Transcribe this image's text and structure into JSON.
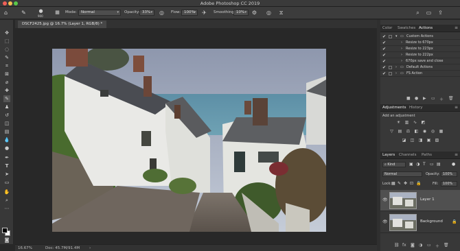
{
  "window": {
    "title": "Adobe Photoshop CC 2019"
  },
  "options_bar": {
    "brush_size": "900",
    "mode_label": "Mode:",
    "mode_value": "Normal",
    "opacity_label": "Opacity:",
    "opacity_value": "33%",
    "flow_label": "Flow:",
    "flow_value": "100%",
    "smoothing_label": "Smoothing:",
    "smoothing_value": "10%"
  },
  "document": {
    "tab_title": "DSCF2425.jpg @ 16.7% (Layer 1, RGB/8) *"
  },
  "status_bar": {
    "zoom": "16.67%",
    "doc_info": "Doc: 45.7M/91.4M"
  },
  "top_panel": {
    "tabs": [
      "Color",
      "Swatches",
      "Actions"
    ],
    "actions": [
      {
        "label": "Custom Actions",
        "type": "set",
        "expanded": true
      },
      {
        "label": "Resize to 670px",
        "type": "action"
      },
      {
        "label": "Resize to 223px",
        "type": "action"
      },
      {
        "label": "Resize to 222px",
        "type": "action"
      },
      {
        "label": "670px save and close",
        "type": "action"
      },
      {
        "label": "Default Actions",
        "type": "set",
        "expanded": false
      },
      {
        "label": "FS Action",
        "type": "set",
        "expanded": false
      }
    ]
  },
  "adjustments_panel": {
    "tabs": [
      "Adjustments",
      "History"
    ],
    "hint": "Add an adjustment",
    "icons": [
      "brightness-contrast-icon",
      "levels-icon",
      "curves-icon",
      "exposure-icon",
      "vibrance-icon",
      "hue-saturation-icon",
      "color-balance-icon",
      "black-white-icon",
      "photo-filter-icon",
      "channel-mixer-icon",
      "color-lookup-icon",
      "invert-icon",
      "posterize-icon",
      "threshold-icon",
      "selective-color-icon",
      "gradient-map-icon"
    ]
  },
  "layers_panel": {
    "tabs": [
      "Layers",
      "Channels",
      "Paths"
    ],
    "filter_kind": "Kind",
    "blend_mode": "Normal",
    "opacity_label": "Opacity:",
    "opacity_value": "100%",
    "lock_label": "Lock:",
    "fill_label": "Fill:",
    "fill_value": "100%",
    "layers": [
      {
        "name": "Layer 1",
        "selected": true
      },
      {
        "name": "Background",
        "selected": false
      }
    ]
  },
  "colors": {
    "app_bg": "#282828",
    "panel_bg": "#383838",
    "accent_close": "#ee5f57",
    "accent_min": "#f5be4f",
    "accent_max": "#59c84a"
  }
}
